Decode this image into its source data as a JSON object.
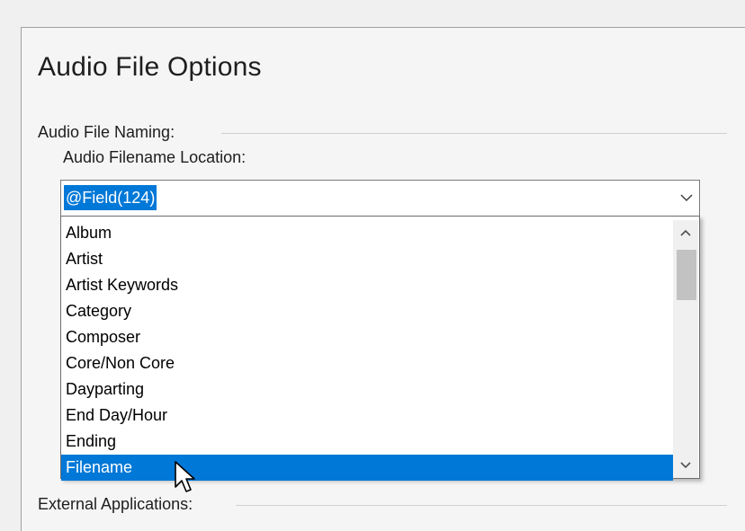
{
  "page": {
    "title": "Audio File Options"
  },
  "groups": {
    "naming": "Audio File Naming:",
    "external": "External Applications:"
  },
  "filename_location": {
    "label": "Audio Filename Location:",
    "value": "@Field(124)",
    "options": [
      "Album",
      "Artist",
      "Artist Keywords",
      "Category",
      "Composer",
      "Core/Non Core",
      "Dayparting",
      "End Day/Hour",
      "Ending",
      "Filename"
    ],
    "highlighted": "Filename"
  },
  "icons": {
    "dropdown_toggle": "chevron-down-icon",
    "scroll_up": "chevron-up-icon",
    "scroll_down": "chevron-down-icon",
    "pointer": "mouse-pointer-icon"
  },
  "colors": {
    "selection": "#0078d7",
    "selection_text": "#ffffff",
    "panel_background": "#f5f5f5",
    "scroll_thumb": "#c2c2c2"
  }
}
